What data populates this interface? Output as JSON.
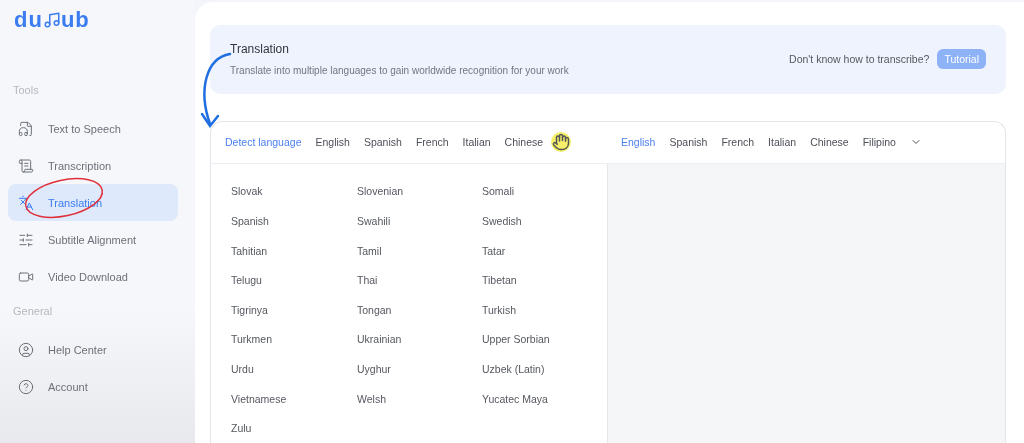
{
  "logo": {
    "left": "du",
    "right": "ub"
  },
  "sidebar": {
    "sections": [
      {
        "title": "Tools",
        "items": [
          {
            "label": "Text to Speech",
            "selected": false
          },
          {
            "label": "Transcription",
            "selected": false
          },
          {
            "label": "Translation",
            "selected": true
          },
          {
            "label": "Subtitle Alignment",
            "selected": false
          },
          {
            "label": "Video Download",
            "selected": false
          }
        ]
      },
      {
        "title": "General",
        "items": [
          {
            "label": "Help Center",
            "selected": false
          },
          {
            "label": "Account",
            "selected": false
          }
        ]
      }
    ]
  },
  "banner": {
    "title": "Translation",
    "subtitle": "Translate into multiple languages to gain worldwide recognition for your work",
    "hint": "Don't know how to transcribe?",
    "button": "Tutorial"
  },
  "source_tabs": [
    {
      "label": "Detect language",
      "selected": true
    },
    {
      "label": "English",
      "selected": false
    },
    {
      "label": "Spanish",
      "selected": false
    },
    {
      "label": "French",
      "selected": false
    },
    {
      "label": "Italian",
      "selected": false
    },
    {
      "label": "Chinese",
      "selected": false
    }
  ],
  "target_tabs": [
    {
      "label": "English",
      "selected": true
    },
    {
      "label": "Spanish",
      "selected": false
    },
    {
      "label": "French",
      "selected": false
    },
    {
      "label": "Italian",
      "selected": false
    },
    {
      "label": "Chinese",
      "selected": false
    },
    {
      "label": "Filipino",
      "selected": false
    }
  ],
  "language_list": [
    "Slovak",
    "Slovenian",
    "Somali",
    "Spanish",
    "Swahili",
    "Swedish",
    "Tahitian",
    "Tamil",
    "Tatar",
    "Telugu",
    "Thai",
    "Tibetan",
    "Tigrinya",
    "Tongan",
    "Turkish",
    "Turkmen",
    "Ukrainian",
    "Upper Sorbian",
    "Urdu",
    "Uyghur",
    "Uzbek (Latin)",
    "Vietnamese",
    "Welsh",
    "Yucatec Maya",
    "Zulu"
  ]
}
